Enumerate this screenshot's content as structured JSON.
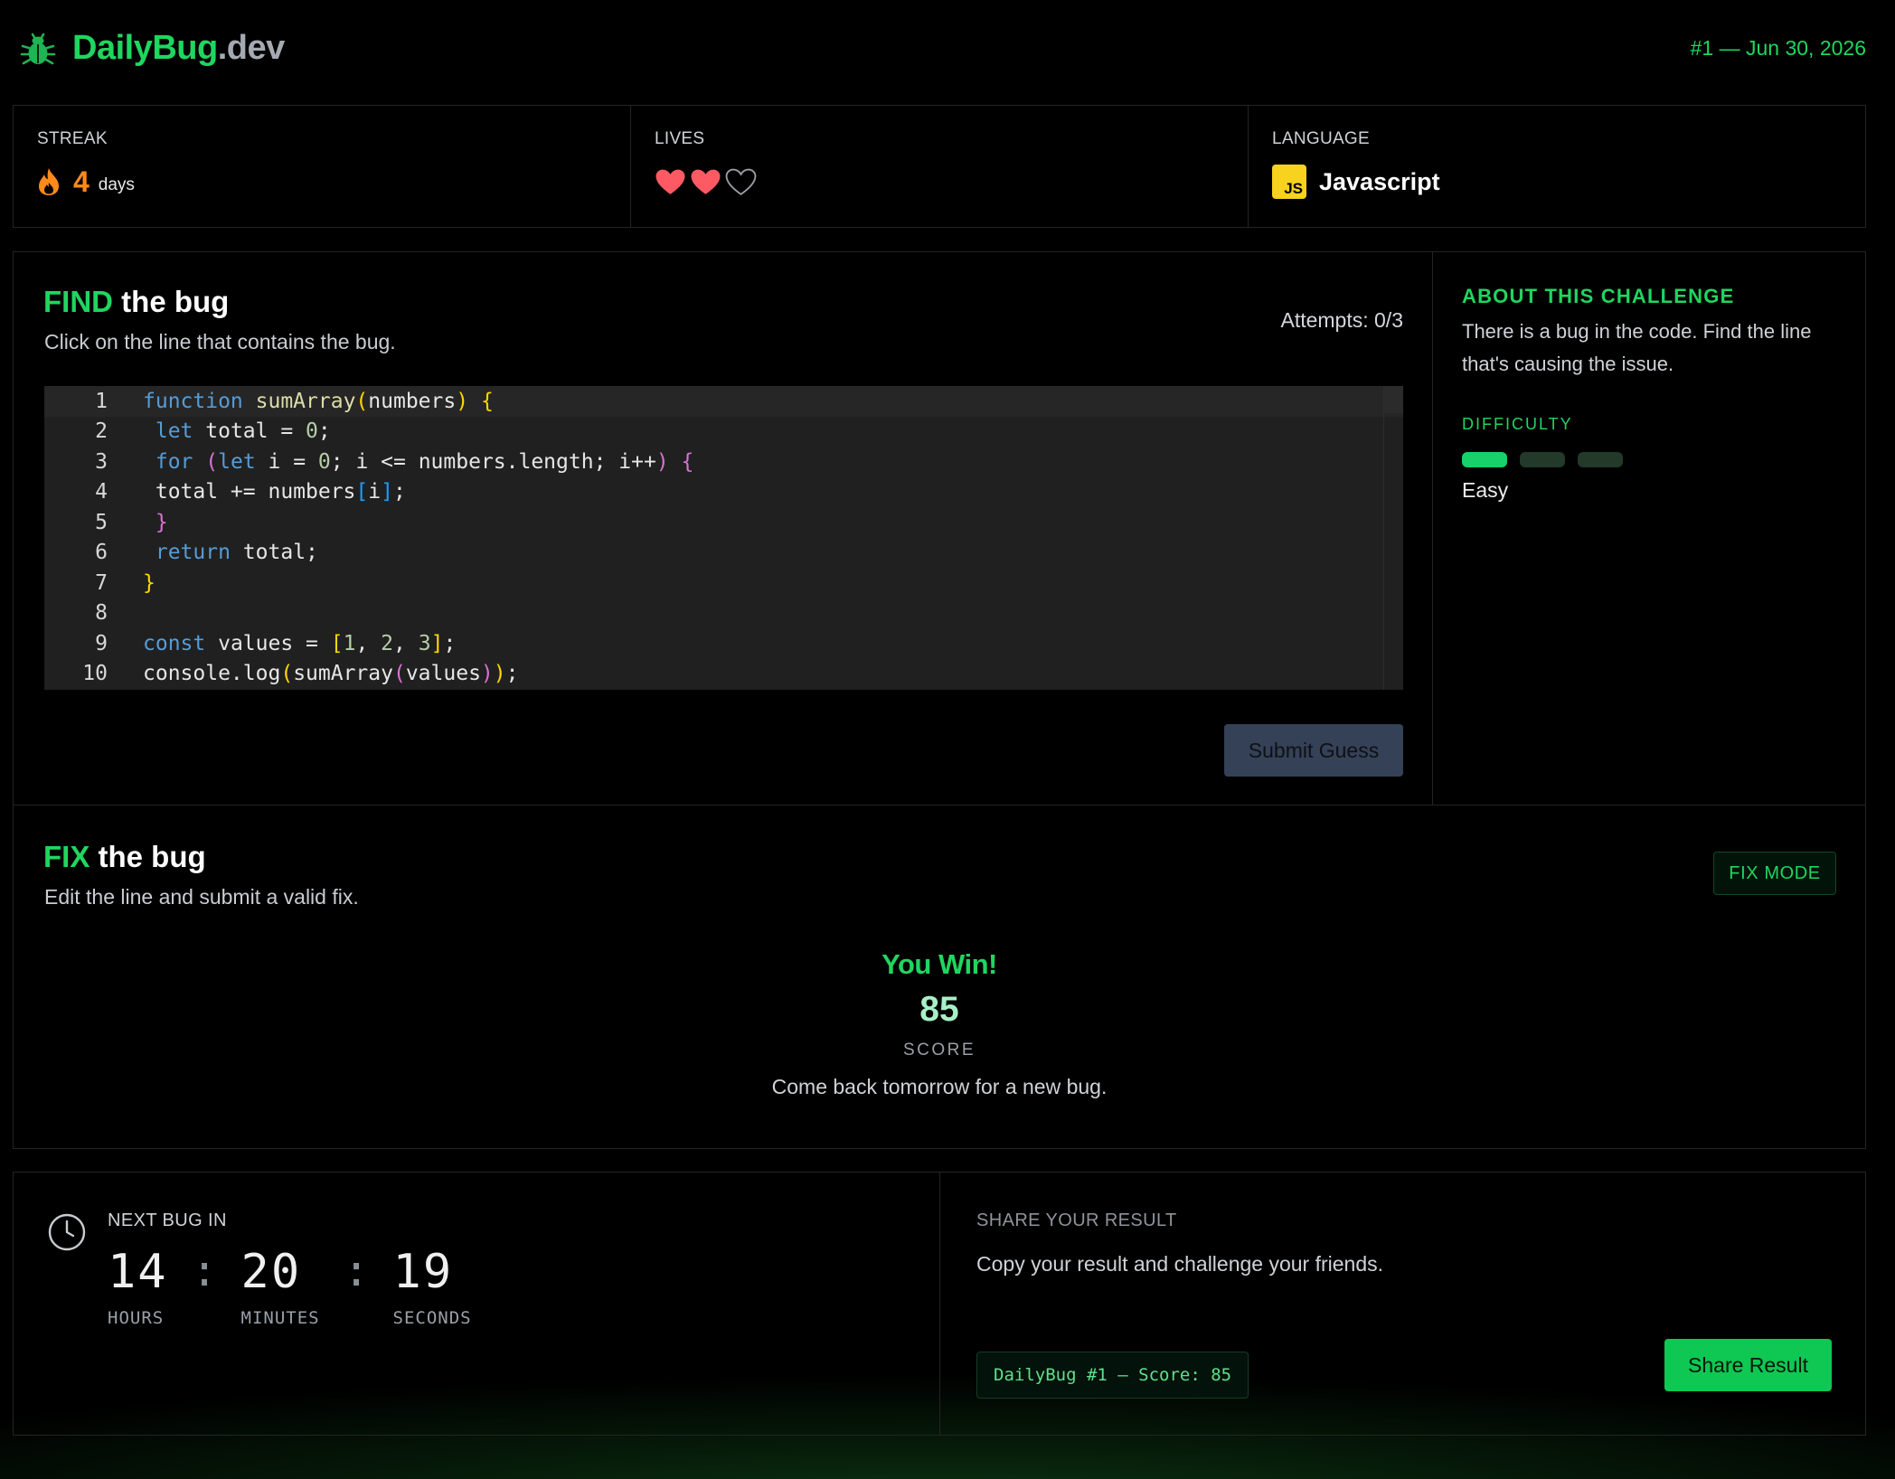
{
  "header": {
    "brand_main": "DailyBug",
    "brand_suffix": ".dev",
    "puzzle_label": "#1 — Jun 30, 2026"
  },
  "stats": {
    "streak": {
      "label": "STREAK",
      "value": "4",
      "unit": "days"
    },
    "lives": {
      "label": "LIVES",
      "total": 3,
      "remaining": 2
    },
    "language": {
      "label": "LANGUAGE",
      "badge": "JS",
      "name": "Javascript"
    }
  },
  "find": {
    "title_accent": "FIND",
    "title_rest": " the bug",
    "subtitle": "Click on the line that contains the bug.",
    "attempts": "Attempts: 0/3",
    "submit_label": "Submit Guess",
    "code_lines": [
      {
        "n": "1"
      },
      {
        "n": "2"
      },
      {
        "n": "3"
      },
      {
        "n": "4"
      },
      {
        "n": "5"
      },
      {
        "n": "6"
      },
      {
        "n": "7"
      },
      {
        "n": "8"
      },
      {
        "n": "9"
      },
      {
        "n": "10"
      }
    ]
  },
  "about": {
    "title": "ABOUT THIS CHALLENGE",
    "text": "There is a bug in the code. Find the line that's causing the issue.",
    "difficulty_label": "DIFFICULTY",
    "difficulty_level": 1,
    "difficulty_max": 3,
    "difficulty_value": "Easy"
  },
  "fix": {
    "title_accent": "FIX",
    "title_rest": " the bug",
    "subtitle": "Edit the line and submit a valid fix.",
    "mode_badge": "FIX MODE",
    "win_text": "You Win!",
    "score": "85",
    "score_label": "SCORE",
    "message": "Come back tomorrow for a new bug."
  },
  "countdown": {
    "label": "NEXT BUG IN",
    "hours": "14",
    "minutes": "20",
    "seconds": "19",
    "hours_label": "HOURS",
    "minutes_label": "MINUTES",
    "seconds_label": "SECONDS",
    "separator": ":"
  },
  "share": {
    "label": "SHARE YOUR RESULT",
    "text": "Copy your result and challenge your friends.",
    "result_text": "DailyBug #1 — Score: 85",
    "button_label": "Share Result"
  },
  "colors": {
    "accent": "#1fd65f",
    "streak": "#ff8a1a",
    "heart": "#ff5a64",
    "js_badge": "#f7d21e",
    "button_share": "#0fc753",
    "button_submit": "#344156"
  },
  "icons": {
    "logo": "bug-icon",
    "streak": "flame-icon",
    "lives": "heart-icon",
    "countdown": "clock-icon"
  }
}
